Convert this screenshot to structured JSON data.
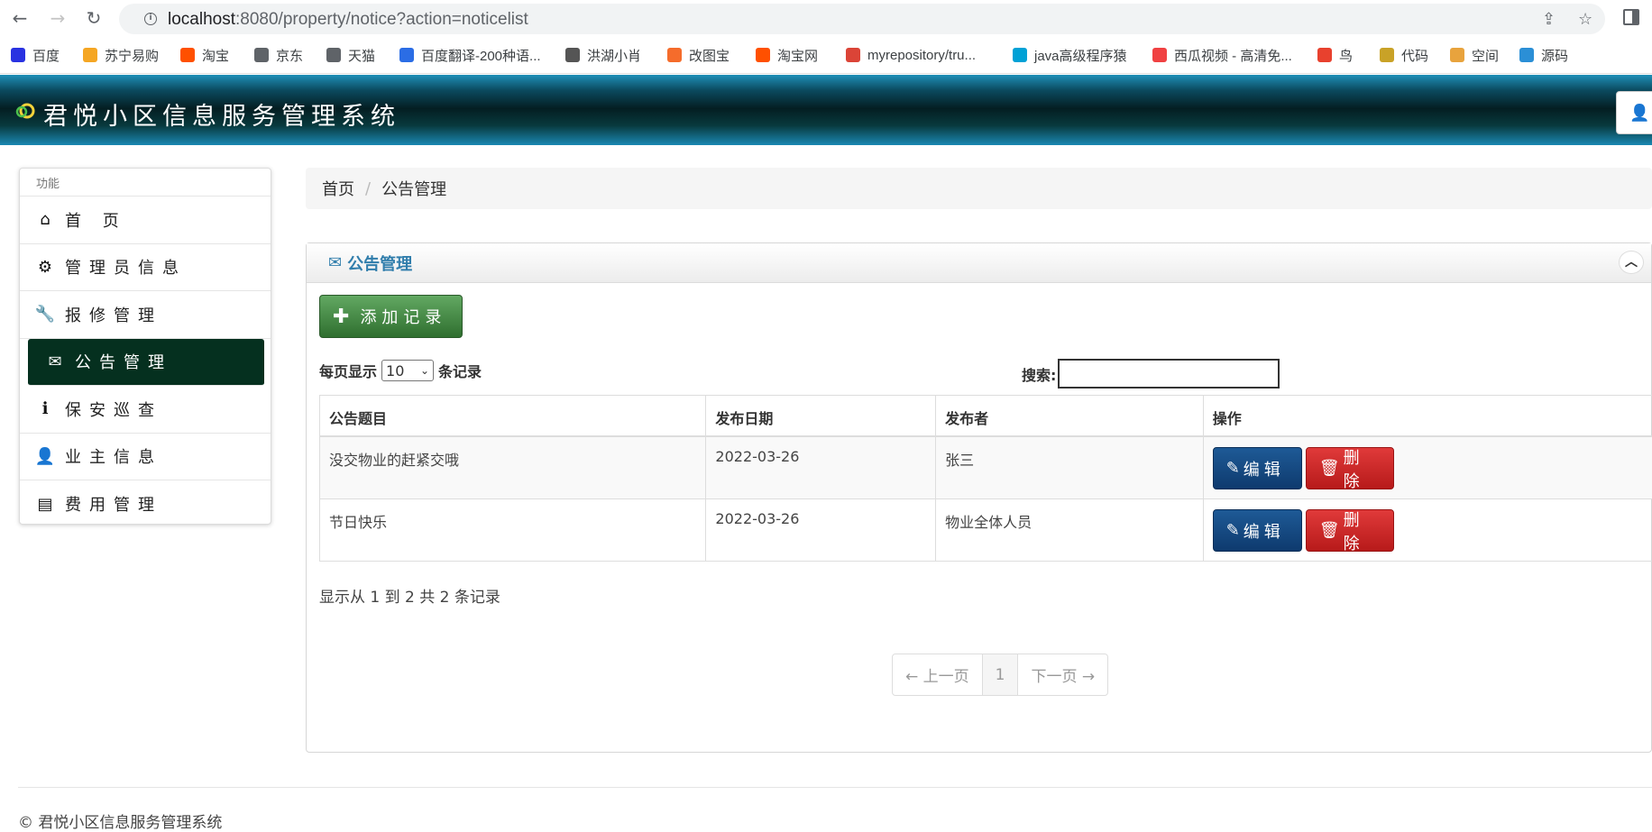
{
  "browser": {
    "url_host": "localhost",
    "url_path": ":8080/property/notice?action=noticelist",
    "bookmarks": [
      {
        "label": "百度",
        "icon": "baidu-icon",
        "color": "#2932e1"
      },
      {
        "label": "苏宁易购",
        "icon": "suning-icon",
        "color": "#f5a623"
      },
      {
        "label": "淘宝",
        "icon": "taobao-icon",
        "color": "#ff5000"
      },
      {
        "label": "京东",
        "icon": "globe-icon",
        "color": "#5f6368"
      },
      {
        "label": "天猫",
        "icon": "globe-icon",
        "color": "#5f6368"
      },
      {
        "label": "百度翻译-200种语...",
        "icon": "translate-icon",
        "color": "#2b6de5"
      },
      {
        "label": "洪湖小肖",
        "icon": "bird-icon",
        "color": "#555555"
      },
      {
        "label": "改图宝",
        "icon": "gaitubao-icon",
        "color": "#f56c2b"
      },
      {
        "label": "淘宝网",
        "icon": "taobao-icon",
        "color": "#ff5000"
      },
      {
        "label": "myrepository/tru...",
        "icon": "chrome-icon",
        "color": "#db4437"
      },
      {
        "label": "java高级程序猿",
        "icon": "bilibili-icon",
        "color": "#00a1d6"
      },
      {
        "label": "西瓜视频 - 高清免...",
        "icon": "xigua-icon",
        "color": "#f04142"
      },
      {
        "label": "鸟",
        "icon": "bird-icon",
        "color": "#e8412e"
      },
      {
        "label": "代码",
        "icon": "code-icon",
        "color": "#c9a227"
      },
      {
        "label": "空间",
        "icon": "qzone-icon",
        "color": "#e8a33d"
      },
      {
        "label": "源码",
        "icon": "fish-icon",
        "color": "#2b8fd6"
      }
    ]
  },
  "header": {
    "title": "君悦小区信息服务管理系统"
  },
  "sidebar": {
    "heading": "功能",
    "items": [
      {
        "label": "首 页",
        "icon": "home-icon",
        "glyph": "⌂"
      },
      {
        "label": "管理员信息",
        "icon": "gear-icon",
        "glyph": "⚙"
      },
      {
        "label": "报修管理",
        "icon": "wrench-icon",
        "glyph": "🔧"
      },
      {
        "label": "公告管理",
        "icon": "envelope-icon",
        "glyph": "✉"
      },
      {
        "label": "保安巡查",
        "icon": "info-icon",
        "glyph": "ℹ"
      },
      {
        "label": "业主信息",
        "icon": "user-icon",
        "glyph": "👤"
      },
      {
        "label": "费用管理",
        "icon": "list-icon",
        "glyph": "▤"
      }
    ],
    "active_index": 3
  },
  "breadcrumb": {
    "home": "首页",
    "separator": "/",
    "current": "公告管理"
  },
  "panel": {
    "title": "公告管理",
    "add_button": "添加记录",
    "length_prefix": "每页显示",
    "length_value": "10",
    "length_suffix": "条记录",
    "search_label": "搜索:",
    "search_value": ""
  },
  "table": {
    "headers": [
      "公告题目",
      "发布日期",
      "发布者",
      "操作"
    ],
    "rows": [
      {
        "title": "没交物业的赶紧交哦",
        "date": "2022-03-26",
        "publisher": "张三"
      },
      {
        "title": "节日快乐",
        "date": "2022-03-26",
        "publisher": "物业全体人员"
      }
    ],
    "edit_label": "编辑",
    "delete_label": "删除"
  },
  "info": "显示从 1 到 2 共 2 条记录",
  "pagination": {
    "prev": "← 上一页",
    "current": "1",
    "next": "下一页 →"
  },
  "footer": {
    "text": "© 君悦小区信息服务管理系统"
  }
}
